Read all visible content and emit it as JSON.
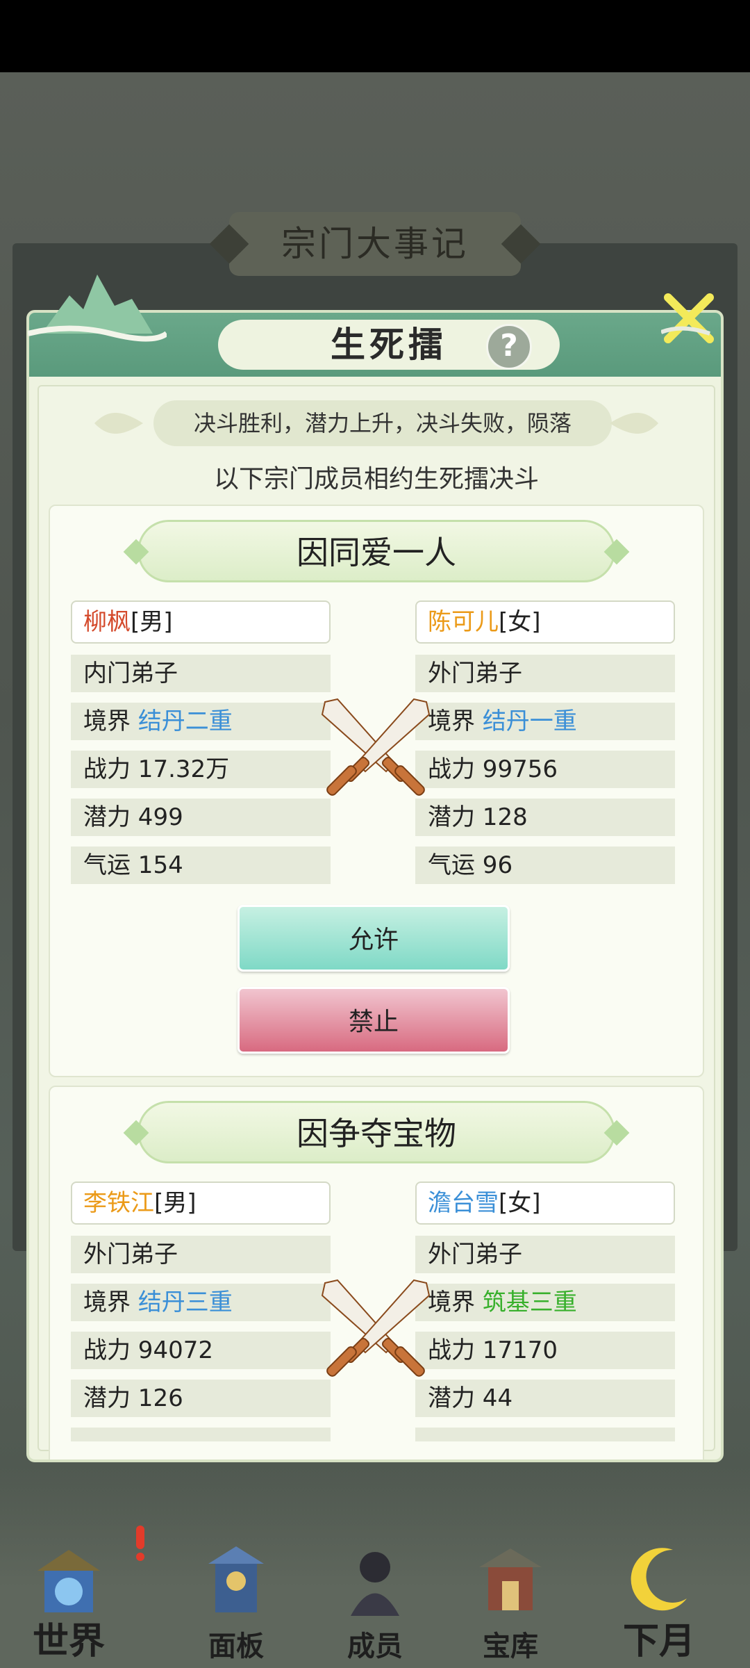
{
  "background_title": "宗门大事记",
  "modal": {
    "title": "生死擂",
    "help_label": "?",
    "rule_text": "决斗胜利，潜力上升，决斗失败，陨落",
    "subtitle": "以下宗门成员相约生死擂决斗"
  },
  "duels": [
    {
      "reason": "因同爱一人",
      "left": {
        "name": "柳枫",
        "gender": "[男]",
        "rank": "内门弟子",
        "realm_label": "境界",
        "realm": "结丹二重",
        "power": "战力 17.32万",
        "potential": "潜力 499",
        "luck": "气运 154"
      },
      "right": {
        "name": "陈可儿",
        "gender": "[女]",
        "rank": "外门弟子",
        "realm_label": "境界",
        "realm": "结丹一重",
        "power": "战力 99756",
        "potential": "潜力 128",
        "luck": "气运 96"
      },
      "allow_label": "允许",
      "deny_label": "禁止"
    },
    {
      "reason": "因争夺宝物",
      "left": {
        "name": "李铁江",
        "gender": "[男]",
        "rank": "外门弟子",
        "realm_label": "境界",
        "realm": "结丹三重",
        "power": "战力 94072",
        "potential": "潜力 126"
      },
      "right": {
        "name": "澹台雪",
        "gender": "[女]",
        "rank": "外门弟子",
        "realm_label": "境界",
        "realm": "筑基三重",
        "power": "战力 17170",
        "potential": "潜力 44"
      }
    }
  ],
  "bottom_nav": [
    {
      "label": "世界",
      "icon": "palace-icon"
    },
    {
      "label": "面板",
      "icon": "character-panel-icon"
    },
    {
      "label": "成员",
      "icon": "member-icon"
    },
    {
      "label": "宝库",
      "icon": "treasury-icon"
    },
    {
      "label": "下月",
      "icon": "moon-icon"
    }
  ],
  "colors": {
    "name_red": "#d44a2c",
    "name_orange": "#eb9a18",
    "name_blue": "#3a8fd7",
    "realm_blue": "#3a8fd7",
    "realm_green": "#38b02c"
  }
}
